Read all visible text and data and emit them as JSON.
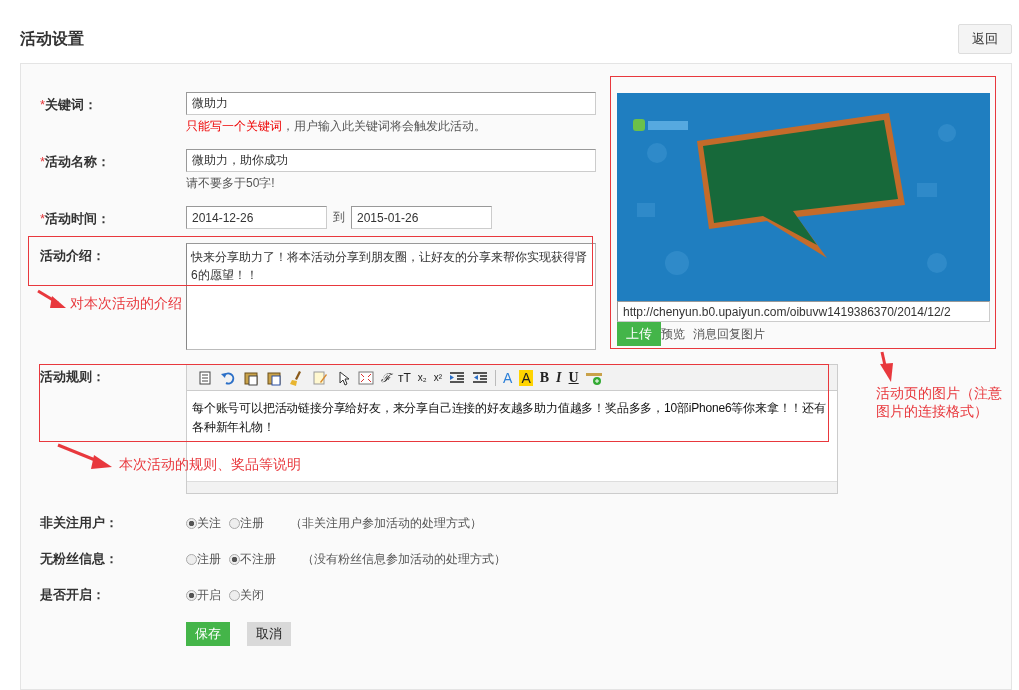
{
  "page_title": "活动设置",
  "back_button": "返回",
  "fields": [
    {
      "kind": "text",
      "label": "关键词：",
      "required_mark": "*",
      "value": "微助力",
      "hint": [
        {
          "text": "只能写一个关键词",
          "warn": true
        },
        {
          "text": "，用户输入此关键词将会触发此活动。",
          "warn": false
        }
      ]
    },
    {
      "kind": "text",
      "label": "活动名称：",
      "required_mark": "*",
      "value": "微助力，助你成功",
      "hint": [
        {
          "text": "请不要多于50字!",
          "warn": false
        }
      ]
    },
    {
      "kind": "daterange",
      "label": "活动时间：",
      "required_mark": "*",
      "start": "2014-12-26",
      "separator": "到",
      "end": "2015-01-26"
    },
    {
      "kind": "textarea",
      "label": "活动介绍：",
      "value": "快来分享助力了！将本活动分享到朋友圈，让好友的分享来帮你实现获得肾6的愿望！！"
    }
  ],
  "image_panel": {
    "url": "http://chenyun.b0.upaiyun.com/oibuvw1419386370/2014/12/2",
    "upload_button": "上传",
    "preview_link": "预览",
    "reply_link": "消息回复图片"
  },
  "rules": {
    "label": "活动规则：",
    "content": "每个账号可以把活动链接分享给好友，来分享自己连接的好友越多助力值越多！奖品多多，10部iPhone6等你来拿！！还有各种新年礼物！",
    "toolbar": [
      {
        "kind": "source"
      },
      {
        "kind": "undo"
      },
      {
        "kind": "paste-text"
      },
      {
        "kind": "paste-word"
      },
      {
        "kind": "clear"
      },
      {
        "kind": "format"
      },
      {
        "kind": "select"
      },
      {
        "kind": "fullscreen"
      },
      {
        "kind": "font",
        "label": "ℱ"
      },
      {
        "kind": "fontsize",
        "label": "ᴛT"
      },
      {
        "kind": "sub",
        "label": "x₂"
      },
      {
        "kind": "sup",
        "label": "x²"
      },
      {
        "kind": "indent"
      },
      {
        "kind": "outdent"
      },
      {
        "kind": "separator"
      },
      {
        "kind": "forecolor",
        "label": "A"
      },
      {
        "kind": "backcolor",
        "label": "A"
      },
      {
        "kind": "bold",
        "label": "B"
      },
      {
        "kind": "italic",
        "label": "I"
      },
      {
        "kind": "underline",
        "label": "U"
      },
      {
        "kind": "hr"
      }
    ]
  },
  "radio_groups": [
    {
      "label": "非关注用户：",
      "options": [
        {
          "text": "关注",
          "selected": true
        },
        {
          "text": "注册",
          "selected": false
        }
      ],
      "note": "（非关注用户参加活动的处理方式）"
    },
    {
      "label": "无粉丝信息：",
      "options": [
        {
          "text": "注册",
          "selected": false
        },
        {
          "text": "不注册",
          "selected": true
        }
      ],
      "note": "（没有粉丝信息参加活动的处理方式）"
    },
    {
      "label": "是否开启：",
      "options": [
        {
          "text": "开启",
          "selected": true
        },
        {
          "text": "关闭",
          "selected": false
        }
      ]
    }
  ],
  "save_button": "保存",
  "cancel_button": "取消",
  "annotations": [
    {
      "kind": "intro",
      "text": "对本次活动的介绍"
    },
    {
      "kind": "image",
      "text": "活动页的图片（注意图片的连接格式）"
    },
    {
      "kind": "rules",
      "text": "本次活动的规则、奖品等说明"
    }
  ]
}
